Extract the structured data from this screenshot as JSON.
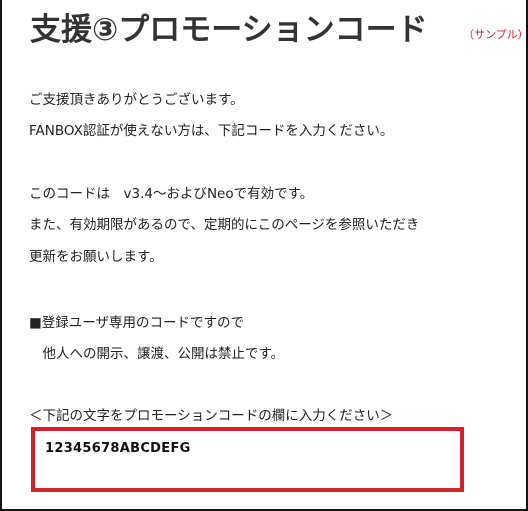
{
  "header": {
    "title": "支援③プロモーションコード",
    "sample_label": "（サンプル）"
  },
  "body": {
    "lines": [
      "ご支援頂きありがとうございます。",
      "FANBOX認証が使えない方は、下記コードを入力ください。",
      "このコードは　v3.4～およびNeoで有効です。",
      "また、有効期限があるので、定期的にこのページを参照いただき",
      "更新をお願いします。",
      "■登録ユーザ専用のコードですので",
      "　他人への開示、譲渡、公開は禁止です。",
      "＜下記の文字をプロモーションコードの欄に入力ください＞"
    ]
  },
  "code_box": {
    "code": "12345678ABCDEFG",
    "border_color": "#d0222b"
  },
  "colors": {
    "accent": "#d0222b",
    "title": "#333333",
    "text": "#222222"
  }
}
